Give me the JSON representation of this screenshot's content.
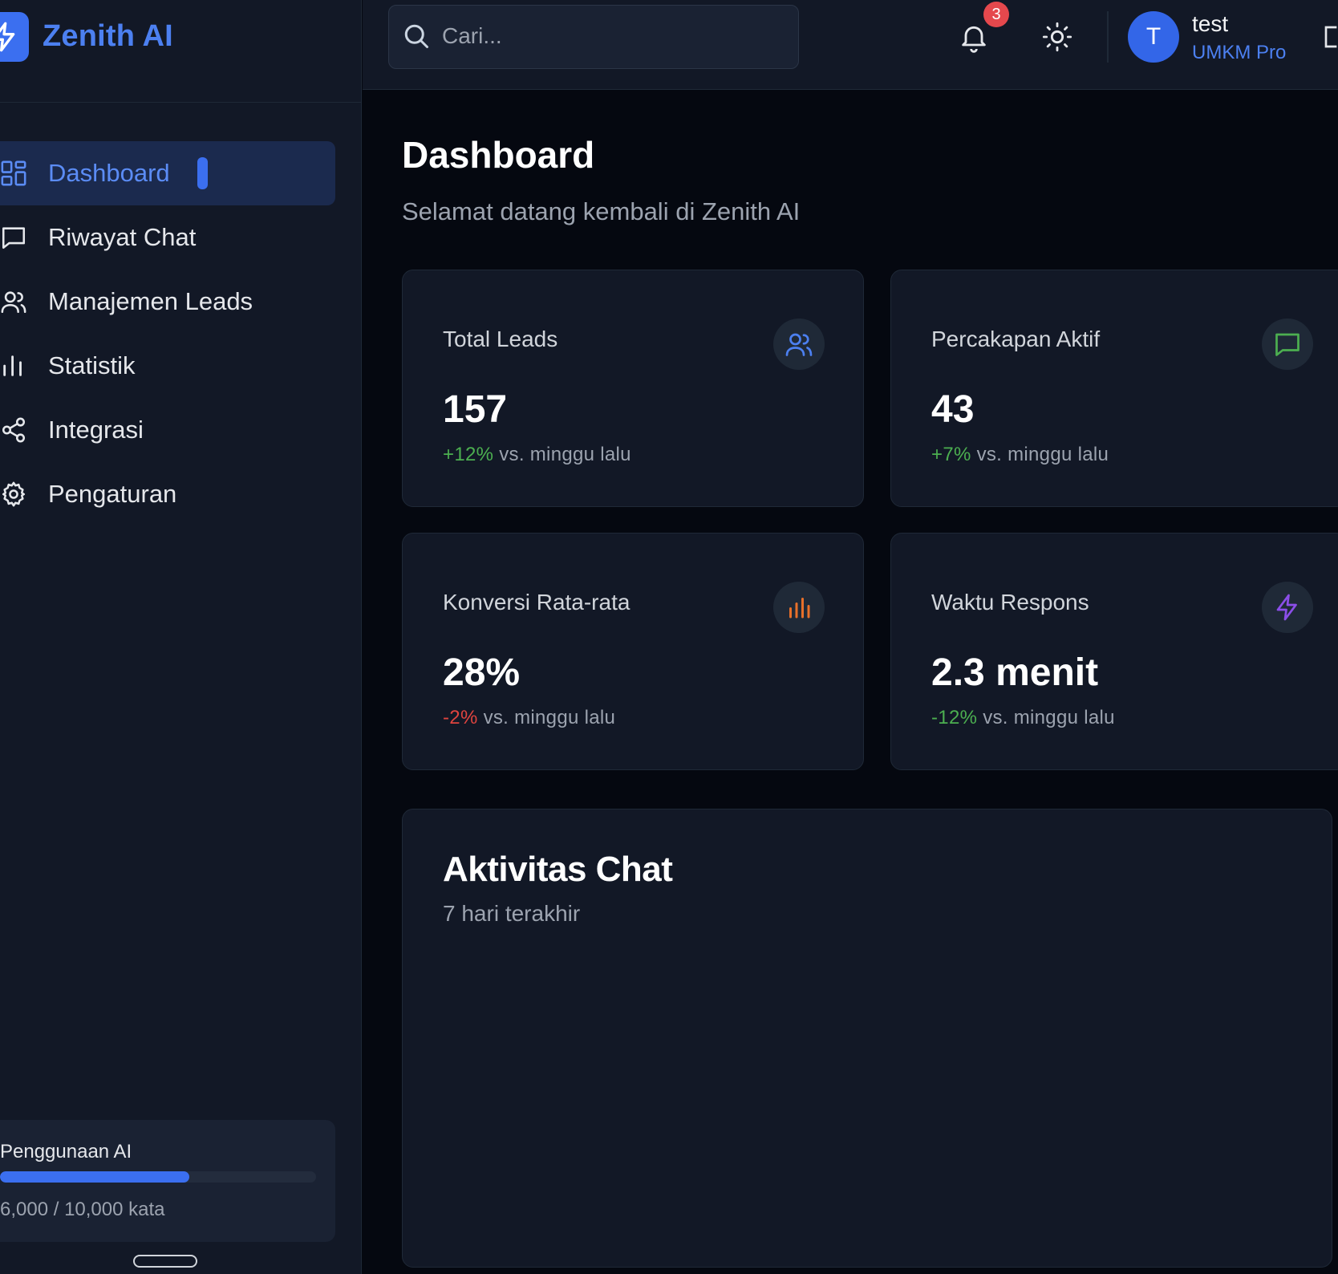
{
  "brand": {
    "name": "Zenith AI"
  },
  "sidebar": {
    "items": [
      {
        "label": "Dashboard",
        "icon": "dashboard-grid-icon",
        "active": true
      },
      {
        "label": "Riwayat Chat",
        "icon": "chat-bubble-icon",
        "active": false
      },
      {
        "label": "Manajemen Leads",
        "icon": "users-icon",
        "active": false
      },
      {
        "label": "Statistik",
        "icon": "bar-chart-icon",
        "active": false
      },
      {
        "label": "Integrasi",
        "icon": "share-icon",
        "active": false
      },
      {
        "label": "Pengaturan",
        "icon": "gear-icon",
        "active": false
      }
    ],
    "usage": {
      "title": "Penggunaan AI",
      "text": "6,000 / 10,000 kata",
      "fraction": 0.6
    }
  },
  "header": {
    "search": {
      "placeholder": "Cari...",
      "value": ""
    },
    "notifications_count": "3",
    "user": {
      "initial": "T",
      "name": "test",
      "plan": "UMKM Pro"
    }
  },
  "main": {
    "title": "Dashboard",
    "subtitle": "Selamat datang kembali di Zenith AI",
    "cards": [
      {
        "title": "Total Leads",
        "value": "157",
        "change": "+12%",
        "change_suffix": "vs. minggu lalu",
        "change_color": "#4caf50",
        "icon": "users-icon",
        "icon_color": "#4c80f1"
      },
      {
        "title": "Percakapan Aktif",
        "value": "43",
        "change": "+7%",
        "change_suffix": "vs. minggu lalu",
        "change_color": "#4caf50",
        "icon": "chat-bubble-icon",
        "icon_color": "#4caf50"
      },
      {
        "title": "Konversi Rata-rata",
        "value": "28%",
        "change": "-2%",
        "change_suffix": "vs. minggu lalu",
        "change_color": "#e0443f",
        "icon": "bar-chart-icon",
        "icon_color": "#e8702a"
      },
      {
        "title": "Waktu Respons",
        "value": "2.3 menit",
        "change": "-12%",
        "change_suffix": "vs. minggu lalu",
        "change_color": "#4caf50",
        "icon": "lightning-icon",
        "icon_color": "#8b4ee8"
      }
    ],
    "chart": {
      "title": "Aktivitas Chat",
      "subtitle": "7 hari terakhir"
    }
  },
  "colors": {
    "accent": "#3b6ff0",
    "background": "#050810",
    "surface": "#121826",
    "positive": "#4caf50",
    "negative": "#e0443f"
  }
}
